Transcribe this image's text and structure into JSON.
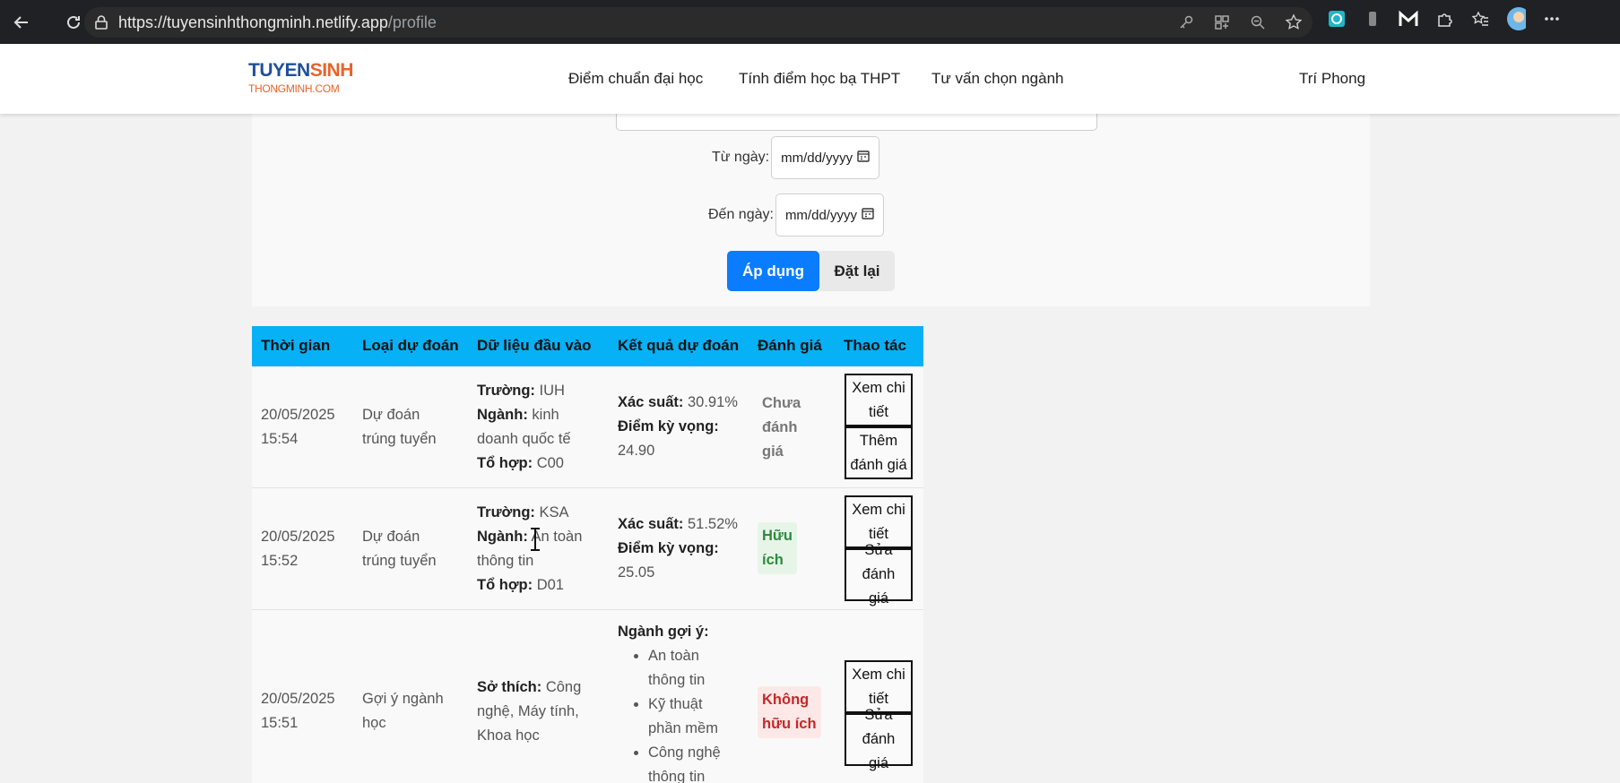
{
  "browser": {
    "url_host": "https://tuyensinhthongminh.netlify.app",
    "url_path": "/profile"
  },
  "site": {
    "logo_top_a": "TUYEN",
    "logo_top_b": "SINH",
    "logo_bottom": "THONGMINH.COM",
    "nav": [
      "Điểm chuẩn đại học",
      "Tính điểm học bạ THPT",
      "Tư vấn chọn ngành"
    ],
    "user": "Trí Phong"
  },
  "filters": {
    "from_label": "Từ ngày:",
    "to_label": "Đến ngày:",
    "date_placeholder": "mm/dd/yyyy",
    "apply": "Áp dụng",
    "reset": "Đặt lại"
  },
  "table": {
    "headers": [
      "Thời gian",
      "Loại dự đoán",
      "Dữ liệu đầu vào",
      "Kết quả dự đoán",
      "Đánh giá",
      "Thao tác"
    ],
    "labels": {
      "school": "Trường:",
      "major": "Ngành:",
      "combo": "Tổ hợp:",
      "prob": "Xác suất:",
      "expected": "Điểm kỳ vọng:",
      "hobby": "Sở thích:",
      "suggested": "Ngành gợi ý:"
    },
    "rows": [
      {
        "date": "20/05/2025",
        "time": "15:54",
        "type_l1": "Dự đoán",
        "type_l2": "trúng tuyển",
        "school": "IUH",
        "major_l1": "kinh",
        "major_l2": "doanh quốc tế",
        "combo": "C00",
        "prob": "30.91%",
        "expected": "24.90",
        "rating_l1": "Chưa",
        "rating_l2": "đánh",
        "rating_l3": "giá",
        "btn1_l1": "Xem chi",
        "btn1_l2": "tiết",
        "btn2_l1": "Thêm",
        "btn2_l2": "đánh giá"
      },
      {
        "date": "20/05/2025",
        "time": "15:52",
        "type_l1": "Dự đoán",
        "type_l2": "trúng tuyển",
        "school": "KSA",
        "major_l1": "An toàn",
        "major_l2": "thông tin",
        "combo": "D01",
        "prob": "51.52%",
        "expected": "25.05",
        "rating_l1": "Hữu",
        "rating_l2": "ích",
        "btn1_l1": "Xem chi",
        "btn1_l2": "tiết",
        "btn2_l1": "Sửa đánh",
        "btn2_l2": "giá"
      },
      {
        "date": "20/05/2025",
        "time": "15:51",
        "type_l1": "Gợi ý ngành",
        "type_l2": "học",
        "hobby_l1": "Công",
        "hobby_l2": "nghệ, Máy tính,",
        "hobby_l3": "Khoa học",
        "suggest": [
          {
            "l1": "An toàn",
            "l2": "thông tin"
          },
          {
            "l1": "Kỹ thuật",
            "l2": "phần mềm"
          },
          {
            "l1": "Công nghệ",
            "l2": "thông tin"
          }
        ],
        "rating_l1": "Không",
        "rating_l2": "hữu ích",
        "btn1_l1": "Xem chi",
        "btn1_l2": "tiết",
        "btn2_l1": "Sửa đánh",
        "btn2_l2": "giá"
      }
    ]
  }
}
